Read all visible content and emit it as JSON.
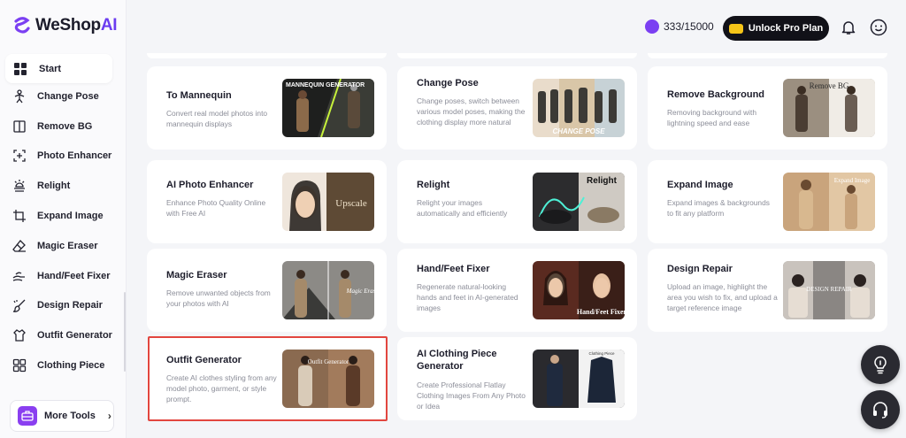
{
  "brand": {
    "name_main": "WeShop",
    "name_accent": "AI"
  },
  "sidebar": {
    "start": {
      "label": "Start",
      "icon": "grid-icon"
    },
    "items": [
      {
        "label": "Change Pose",
        "icon": "pose-icon"
      },
      {
        "label": "Remove BG",
        "icon": "split-icon"
      },
      {
        "label": "Photo Enhancer",
        "icon": "enhance-icon"
      },
      {
        "label": "Relight",
        "icon": "light-icon"
      },
      {
        "label": "Expand Image",
        "icon": "expand-icon"
      },
      {
        "label": "Magic Eraser",
        "icon": "eraser-icon"
      },
      {
        "label": "Hand/Feet Fixer",
        "icon": "hand-icon"
      },
      {
        "label": "Design Repair",
        "icon": "brush-icon"
      },
      {
        "label": "Outfit Generator",
        "icon": "outfit-icon"
      },
      {
        "label": "Clothing Piece",
        "icon": "clothing-icon"
      }
    ],
    "more_tools": {
      "label": "More Tools",
      "icon": "toolbox-icon"
    }
  },
  "header": {
    "credits": "333/15000",
    "unlock_label": "Unlock Pro Plan",
    "bell_icon": "bell-icon",
    "profile_icon": "smile-icon"
  },
  "cards": [
    {
      "title": "To Mannequin",
      "desc": "Convert real model photos into mannequin displays",
      "thumb_text": "MANNEQUIN GENERATOR"
    },
    {
      "title": "Change Pose",
      "desc": "Change poses, switch between various model poses, making the clothing display more natural",
      "thumb_text": "CHANGE POSE"
    },
    {
      "title": "Remove Background",
      "desc": "Removing background with lightning speed and ease",
      "thumb_text": "Remove BG"
    },
    {
      "title": "AI Photo Enhancer",
      "desc": "Enhance Photo Quality Online with Free AI",
      "thumb_text": "Upscale"
    },
    {
      "title": "Relight",
      "desc": "Relight your images automatically and efficiently",
      "thumb_text": "Relight"
    },
    {
      "title": "Expand Image",
      "desc": "Expand images & backgrounds to fit any platform",
      "thumb_text": "Expand Image"
    },
    {
      "title": "Magic Eraser",
      "desc": "Remove unwanted objects from your photos with AI",
      "thumb_text": "Magic Eraser"
    },
    {
      "title": "Hand/Feet Fixer",
      "desc": "Regenerate natural-looking hands and feet in AI-generated images",
      "thumb_text": "Hand/Feet Fixer"
    },
    {
      "title": "Design Repair",
      "desc": "Upload an image, highlight the area you wish to fix, and upload a target reference image",
      "thumb_text": "DESIGN REPAIR"
    },
    {
      "title": "Outfit Generator",
      "desc": "Create AI clothes styling from any model photo, garment, or style prompt.",
      "thumb_text": "Outfit Generator"
    },
    {
      "title": "AI Clothing Piece Generator",
      "desc": "Create Professional Flatlay Clothing Images From Any Photo or Idea",
      "thumb_text": "Clothing Piece"
    }
  ],
  "floating": {
    "ideas_icon": "lightbulb-icon",
    "support_icon": "headset-icon"
  },
  "colors": {
    "accent": "#6b3cf0",
    "selected_border": "#e2463f",
    "dark_button": "#111118"
  }
}
